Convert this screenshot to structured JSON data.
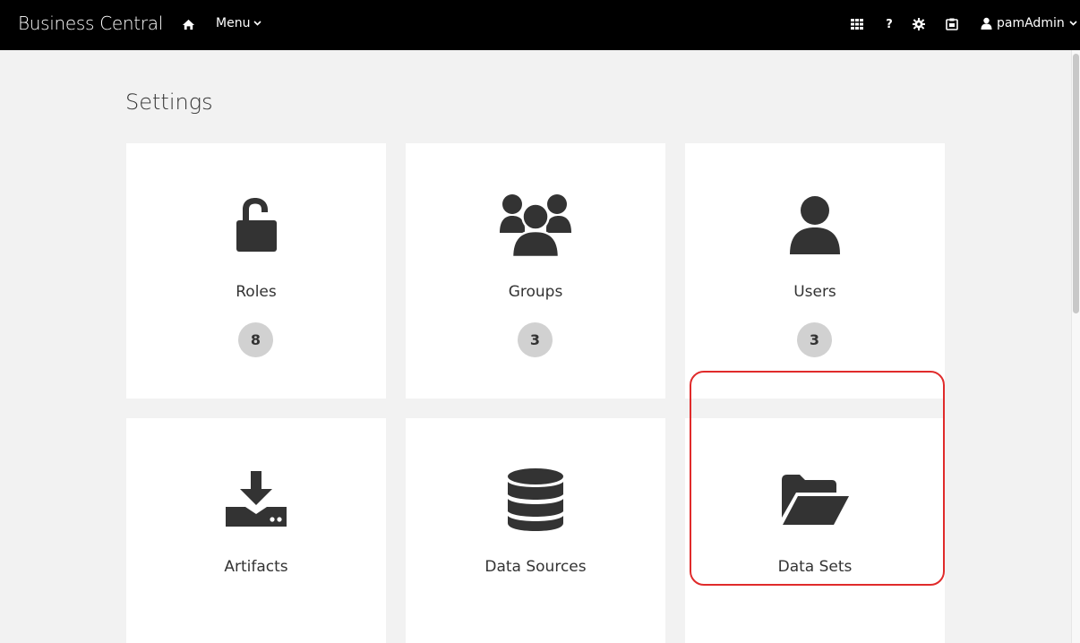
{
  "header": {
    "brand": "Business Central",
    "menu_label": "Menu",
    "user_name": "pamAdmin",
    "icons": [
      "home-icon",
      "apps-grid-icon",
      "help-icon",
      "settings-gear-icon",
      "task-inbox-icon",
      "user-icon",
      "chevron-down-icon"
    ]
  },
  "page": {
    "title": "Settings"
  },
  "cards": [
    {
      "label": "Roles",
      "count": "8",
      "icon": "unlock-icon"
    },
    {
      "label": "Groups",
      "count": "3",
      "icon": "users-group-icon"
    },
    {
      "label": "Users",
      "count": "3",
      "icon": "user-icon"
    },
    {
      "label": "Artifacts",
      "icon": "download-inbox-icon"
    },
    {
      "label": "Data Sources",
      "icon": "database-icon"
    },
    {
      "label": "Data Sets",
      "icon": "folder-open-icon"
    }
  ],
  "highlight_color": "#e02b2b"
}
